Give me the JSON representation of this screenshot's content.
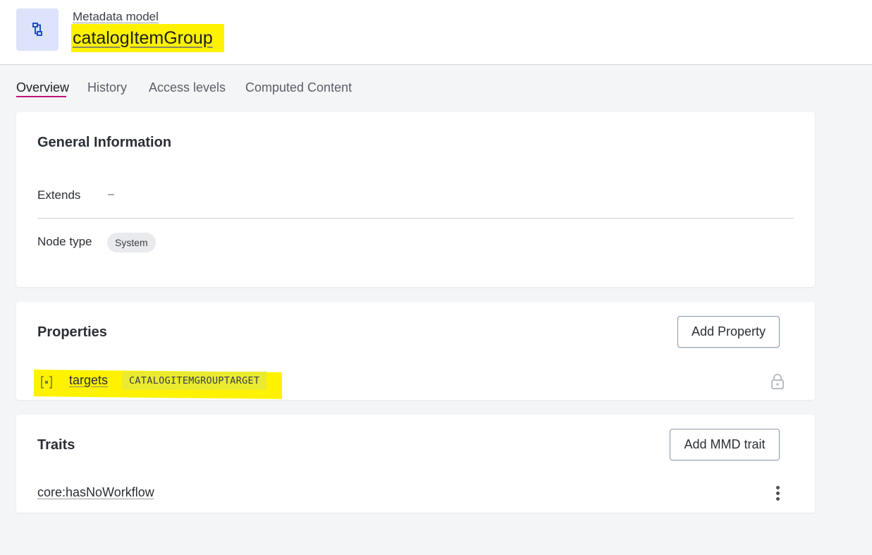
{
  "header": {
    "subtitle": "Metadata model",
    "title": "catalogItemGroup",
    "icon": "metadata-model-icon",
    "highlight_color": "#fff200"
  },
  "tabs": [
    {
      "label": "Overview",
      "active": true
    },
    {
      "label": "History",
      "active": false
    },
    {
      "label": "Access levels",
      "active": false
    },
    {
      "label": "Computed Content",
      "active": false
    }
  ],
  "general_info": {
    "title": "General Information",
    "extends_label": "Extends",
    "extends_value": "–",
    "node_type_label": "Node type",
    "node_type_value": "System"
  },
  "properties": {
    "title": "Properties",
    "add_button": "Add Property",
    "items": [
      {
        "name": "targets",
        "type": "CATALOGITEMGROUPTARGET",
        "icon": "list-property-icon",
        "locked": true
      }
    ]
  },
  "traits": {
    "title": "Traits",
    "add_button": "Add MMD trait",
    "items": [
      {
        "name": "core:hasNoWorkflow"
      }
    ]
  },
  "colors": {
    "accent": "#c0147a",
    "icon_bg": "#dde3fb",
    "icon_fg": "#1f4fc4"
  }
}
